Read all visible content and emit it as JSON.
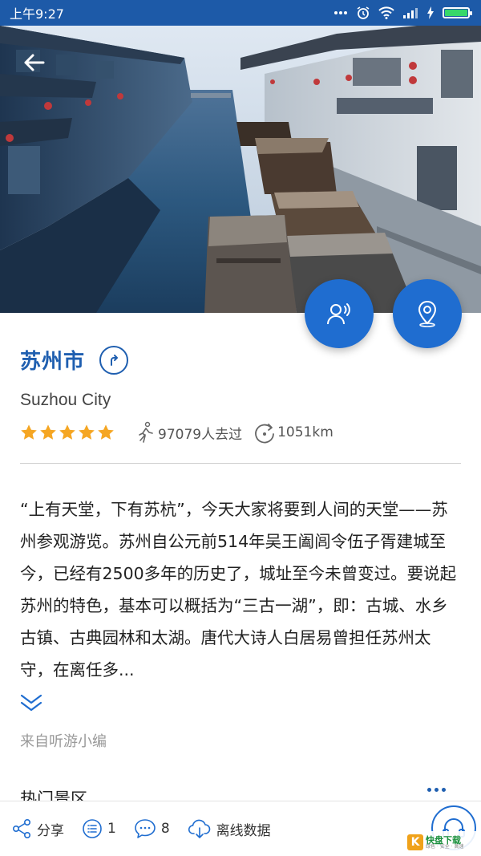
{
  "status_bar": {
    "time": "上午9:27",
    "icons": [
      "more-icon",
      "alarm-icon",
      "wifi-icon",
      "signal-icon",
      "charging-icon",
      "battery-icon"
    ]
  },
  "hero": {
    "back_icon": "arrow-left-icon",
    "fab_audio_icon": "audio-guide-icon",
    "fab_location_icon": "location-pin-icon"
  },
  "city": {
    "title": "苏州市",
    "subtitle": "Suzhou City",
    "rating": 5,
    "visited": "97079人去过",
    "distance": "1051km"
  },
  "description": "“上有天堂，下有苏杭”，今天大家将要到人间的天堂——苏州参观游览。苏州自公元前514年吴王阖闾令伍子胥建城至今，已经有2500多年的历史了，城址至今未曾变过。要说起苏州的特色，基本可以概括为“三古一湖”，即：古城、水乡古镇、古典园林和太湖。唐代大诗人白居易曾担任苏州太守，在离任多...",
  "source_note": "来自听游小编",
  "section": {
    "heading": "热门景区"
  },
  "bottom_bar": {
    "share_label": "分享",
    "list_count": "1",
    "comment_count": "8",
    "offline_label": "离线数据"
  },
  "watermark": {
    "logo_char": "K",
    "name": "快盘下载",
    "tagline": "绿色 · 安全 · 高速"
  },
  "colors": {
    "primary": "#1f5fb0",
    "fab": "#1f6dd0",
    "star": "#f5a623",
    "status_bar": "#1d5aa8"
  }
}
